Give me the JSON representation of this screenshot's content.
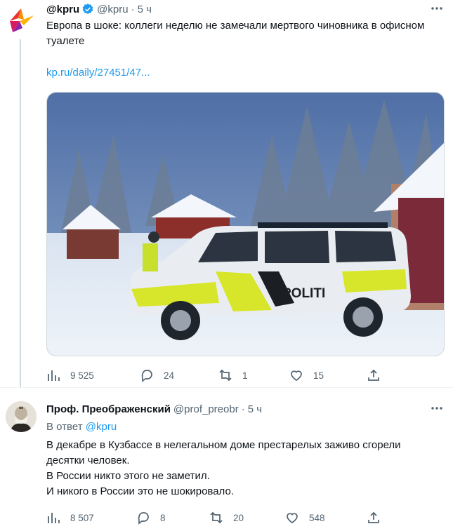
{
  "tweet1": {
    "display_name": "@kpru",
    "handle": "@kpru",
    "dot": "·",
    "time": "5 ч",
    "text": "Европа в шоке: коллеги неделю не замечали мертвого чиновника в офисном туалете",
    "link": "kp.ru/daily/27451/47...",
    "image_text": "POLITI",
    "stats": {
      "views": "9 525",
      "replies": "24",
      "retweets": "1",
      "likes": "15"
    }
  },
  "tweet2": {
    "display_name": "Проф. Преображенский",
    "handle": "@prof_preobr",
    "dot": "·",
    "time": "5 ч",
    "reply_prefix": "В ответ",
    "reply_handle": "@kpru",
    "lines": [
      "В декабре в Кузбассе в нелегальном доме престарелых заживо сгорели",
      "десятки человек.",
      "В России никто этого не заметил.",
      "И никого в России это не шокировало."
    ],
    "stats": {
      "views": "8 507",
      "replies": "8",
      "retweets": "20",
      "likes": "548"
    }
  },
  "colors": {
    "accent": "#1d9bf0",
    "secondary_text": "#536471",
    "brand_kp": "#e53935"
  }
}
